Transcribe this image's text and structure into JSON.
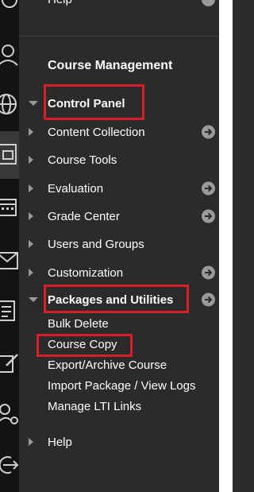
{
  "top_item": {
    "label": "Help"
  },
  "section_title": "Course Management",
  "menu": [
    {
      "label": "Control Panel",
      "bold": true,
      "caret": "down",
      "go": false,
      "highlighted": true
    },
    {
      "label": "Content Collection",
      "bold": false,
      "caret": "right",
      "go": true
    },
    {
      "label": "Course Tools",
      "bold": false,
      "caret": "right",
      "go": false
    },
    {
      "label": "Evaluation",
      "bold": false,
      "caret": "right",
      "go": true
    },
    {
      "label": "Grade Center",
      "bold": false,
      "caret": "right",
      "go": true
    },
    {
      "label": "Users and Groups",
      "bold": false,
      "caret": "right",
      "go": false
    },
    {
      "label": "Customization",
      "bold": false,
      "caret": "right",
      "go": true
    },
    {
      "label": "Packages and Utilities",
      "bold": true,
      "caret": "down",
      "go": true,
      "highlighted": true
    }
  ],
  "packages_subitems": [
    {
      "label": "Bulk Delete"
    },
    {
      "label": "Course Copy",
      "highlighted": true
    },
    {
      "label": "Export/Archive Course"
    },
    {
      "label": "Import Package / View Logs"
    },
    {
      "label": "Manage LTI Links"
    }
  ],
  "bottom_item": {
    "label": "Help"
  },
  "rail_icons": [
    "help-icon",
    "profile-icon",
    "globe-icon",
    "courses-icon",
    "calendar-icon",
    "mail-icon",
    "grades-icon",
    "edit-icon",
    "admin-icon",
    "sign-out-icon"
  ],
  "colors": {
    "highlight": "#d91e27",
    "panel": "#2b2b2b",
    "rail": "#131313",
    "caret": "#9a9a9a"
  }
}
